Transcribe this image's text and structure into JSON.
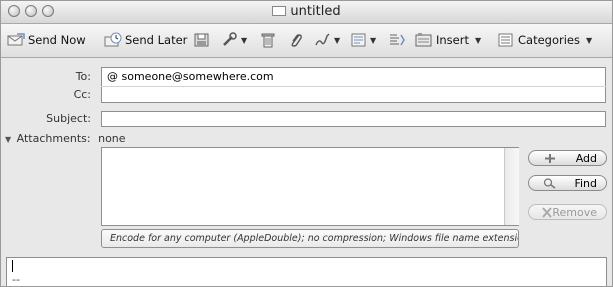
{
  "window": {
    "title": "untitled"
  },
  "toolbar": {
    "send_now": "Send Now",
    "send_later": "Send Later",
    "insert": "Insert",
    "categories": "Categories"
  },
  "header": {
    "to_label": "To:",
    "to_value": "@ someone@somewhere.com",
    "cc_label": "Cc:",
    "subject_label": "Subject:",
    "attachments_label": "Attachments:",
    "attachments_value": "none"
  },
  "attachments": {
    "add": "Add",
    "find": "Find",
    "remove": "Remove",
    "encoding": "Encode for any computer (AppleDouble); no compression; Windows file name extensions"
  },
  "body": {
    "signature": "--"
  }
}
